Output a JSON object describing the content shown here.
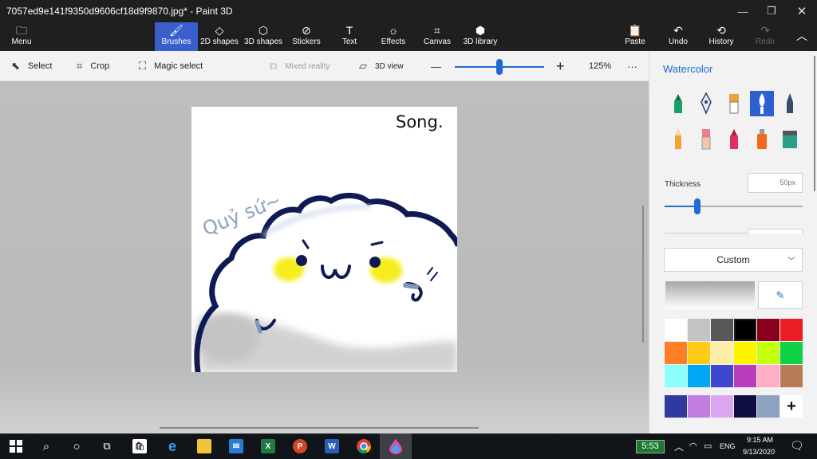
{
  "window": {
    "title": "7057ed9e141f9350d9606cf18d9f9870.jpg* - Paint 3D",
    "controls": [
      "minimize",
      "restore",
      "close"
    ]
  },
  "ribbon": {
    "menu": "Menu",
    "tools": [
      {
        "label": "Brushes",
        "icon": "brush-icon",
        "active": true
      },
      {
        "label": "2D shapes",
        "icon": "2d-shapes-icon"
      },
      {
        "label": "3D shapes",
        "icon": "3d-shapes-icon"
      },
      {
        "label": "Stickers",
        "icon": "stickers-icon"
      },
      {
        "label": "Text",
        "icon": "text-icon"
      },
      {
        "label": "Effects",
        "icon": "effects-icon"
      },
      {
        "label": "Canvas",
        "icon": "canvas-icon"
      },
      {
        "label": "3D library",
        "icon": "3d-library-icon"
      }
    ],
    "paste": "Paste",
    "undo": "Undo",
    "history": "History",
    "redo": "Redo"
  },
  "toolbar": {
    "select": "Select",
    "crop": "Crop",
    "magic_select": "Magic select",
    "mixed_reality": "Mixed reality",
    "view_3d": "3D view",
    "zoom_minus": "—",
    "zoom_plus": "+",
    "zoom_level": "125%",
    "zoom_fraction": 0.5,
    "more": "···"
  },
  "canvas": {
    "text_top": "Song.",
    "text_side": "Quỷ sứ~"
  },
  "panel": {
    "title": "Watercolor",
    "brushes": [
      {
        "name": "marker",
        "color": "#1a9e6a"
      },
      {
        "name": "calligraphy-pen",
        "color": "#2a3f6f"
      },
      {
        "name": "oil-brush",
        "color": "#e8a33a"
      },
      {
        "name": "watercolor",
        "color": "#ffffff",
        "selected": true
      },
      {
        "name": "pixel-pen",
        "color": "#3a4a6a"
      },
      {
        "name": "pencil",
        "color": "#f2a03a"
      },
      {
        "name": "eraser",
        "color": "#f07a90"
      },
      {
        "name": "crayon",
        "color": "#e0305a"
      },
      {
        "name": "spray-can",
        "color": "#f06a1a"
      },
      {
        "name": "fill",
        "color": "#2aa08a"
      }
    ],
    "thickness_label": "Thickness",
    "thickness_value": "50px",
    "thickness_fraction": 0.18,
    "color_mode": "Custom",
    "swatches": [
      "#ffffff",
      "#c3c3c3",
      "#585858",
      "#000000",
      "#88001b",
      "#ec1c24",
      "#ff7f27",
      "#ffca18",
      "#fdeca6",
      "#fff200",
      "#c4ff0e",
      "#0ed145",
      "#8cfffb",
      "#00a8f3",
      "#3f48cc",
      "#b83dba",
      "#ffaec8",
      "#b97a56"
    ],
    "selected_swatch": 3,
    "custom_swatches": [
      "#2e3a9e",
      "#c07fe0",
      "#dba6f0",
      "#0e0f40",
      "#8ba2c0"
    ],
    "add_color": "+"
  },
  "taskbar": {
    "timer": "5:53",
    "language": "ENG",
    "time": "9:15 AM",
    "date": "9/13/2020"
  }
}
